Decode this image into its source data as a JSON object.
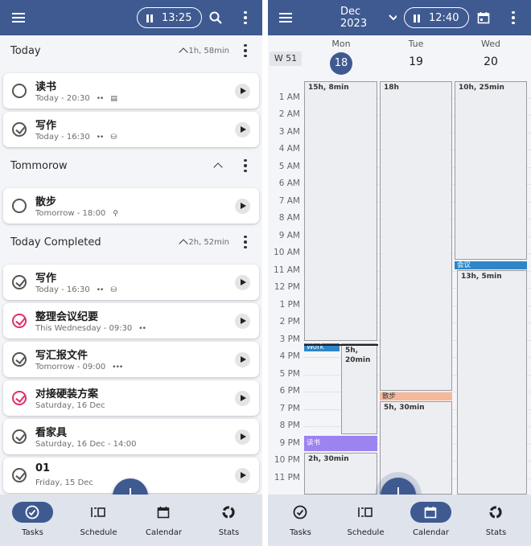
{
  "tasks_screen": {
    "timer": "13:25",
    "sections": [
      {
        "title": "Today",
        "duration": "1h, 58min"
      },
      {
        "title": "Tommorow",
        "duration": ""
      },
      {
        "title": "Today Completed",
        "duration": "2h, 52min"
      }
    ],
    "tasks": [
      {
        "name": "读书",
        "subtitle": "Today - 20:30",
        "indicator": "••",
        "tag": "▤",
        "done": false
      },
      {
        "name": "写作",
        "subtitle": "Today - 16:30",
        "indicator": "••",
        "tag": "⛁",
        "done": true
      },
      {
        "name": "散步",
        "subtitle": "Tomorrow - 18:00",
        "indicator": "",
        "tag": "⚲",
        "done": false
      },
      {
        "name": "写作",
        "subtitle": "Today - 16:30",
        "indicator": "••",
        "tag": "⛁",
        "done": true
      },
      {
        "name": "整理会议纪要",
        "subtitle": "This Wednesday - 09:30",
        "indicator": "••",
        "tag": "",
        "done": true,
        "priority": true
      },
      {
        "name": "写汇报文件",
        "subtitle": "Tomorrow - 09:00",
        "indicator": "•••",
        "tag": "",
        "done": true
      },
      {
        "name": "对接硬装方案",
        "subtitle": "Saturday, 16 Dec",
        "indicator": "",
        "tag": "",
        "done": true,
        "priority": true
      },
      {
        "name": "看家具",
        "subtitle": "Saturday, 16 Dec - 14:00",
        "indicator": "",
        "tag": "",
        "done": true
      },
      {
        "name": "01",
        "subtitle": "Friday, 15 Dec",
        "indicator": "",
        "tag": "",
        "done": true
      }
    ]
  },
  "calendar_screen": {
    "month": "Dec 2023",
    "timer": "12:40",
    "week": "W 51",
    "days": [
      {
        "name": "Mon",
        "date": "18",
        "selected": true
      },
      {
        "name": "Tue",
        "date": "19",
        "selected": false
      },
      {
        "name": "Wed",
        "date": "20",
        "selected": false
      }
    ],
    "hours": [
      "1 AM",
      "2 AM",
      "3 AM",
      "4 AM",
      "5 AM",
      "6 AM",
      "7 AM",
      "8 AM",
      "9 AM",
      "10 AM",
      "11 AM",
      "12 PM",
      "1 PM",
      "2 PM",
      "3 PM",
      "4 PM",
      "5 PM",
      "6 PM",
      "7 PM",
      "8 PM",
      "9 PM",
      "10 PM",
      "11 PM"
    ],
    "free_blocks": [
      "15h, 8min",
      "5h, 20min",
      "2h, 30min",
      "18h",
      "5h, 30min",
      "10h, 25min",
      "13h, 5min"
    ],
    "events": [
      {
        "title": "Work",
        "color": "#2e86c9"
      },
      {
        "title": "读书",
        "color": "#9b83f0"
      },
      {
        "title": "散步",
        "color": "#f5b89a"
      },
      {
        "title": "会议",
        "color": "#2e86c9"
      }
    ]
  },
  "nav": {
    "tabs": [
      "Tasks",
      "Schedule",
      "Calendar",
      "Stats"
    ]
  },
  "colors": {
    "primary": "#3f5a91",
    "priority": "#e0306a",
    "nav_bg": "#dfe3ec"
  }
}
